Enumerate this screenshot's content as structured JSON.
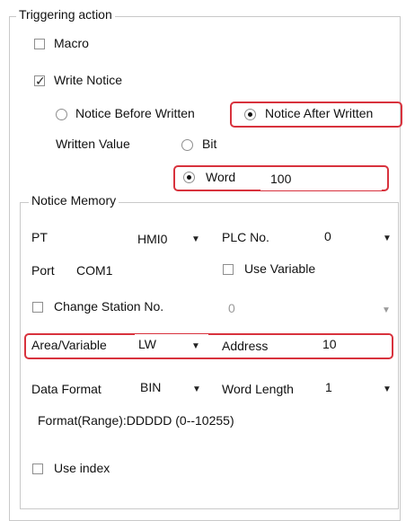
{
  "triggering": {
    "legend": "Triggering action",
    "macro_label": "Macro",
    "write_notice_label": "Write Notice",
    "notice_before_label": "Notice Before Written",
    "notice_after_label": "Notice After Written",
    "written_value_label": "Written Value",
    "bit_label": "Bit",
    "word_label": "Word",
    "word_value": "100"
  },
  "notice_memory": {
    "legend": "Notice Memory",
    "pt_label": "PT",
    "pt_value": "HMI0",
    "plc_no_label": "PLC No.",
    "plc_no_value": "0",
    "port_label": "Port",
    "port_value": "COM1",
    "use_variable_label": "Use Variable",
    "change_station_label": "Change Station No.",
    "change_station_value": "0",
    "area_label": "Area/Variable",
    "area_value": "LW",
    "address_label": "Address",
    "address_value": "10",
    "data_format_label": "Data Format",
    "data_format_value": "BIN",
    "word_length_label": "Word Length",
    "word_length_value": "1",
    "format_range": "Format(Range):DDDDD (0--10255)",
    "use_index_label": "Use index"
  },
  "state": {
    "macro_checked": false,
    "write_notice_checked": true,
    "notice_after_selected": true,
    "word_selected": true,
    "use_variable_checked": false,
    "change_station_checked": false,
    "use_index_checked": false
  },
  "colors": {
    "highlight": "#d8323d",
    "group_border": "#c9c9c9",
    "disabled_text": "#9a9a9a"
  }
}
